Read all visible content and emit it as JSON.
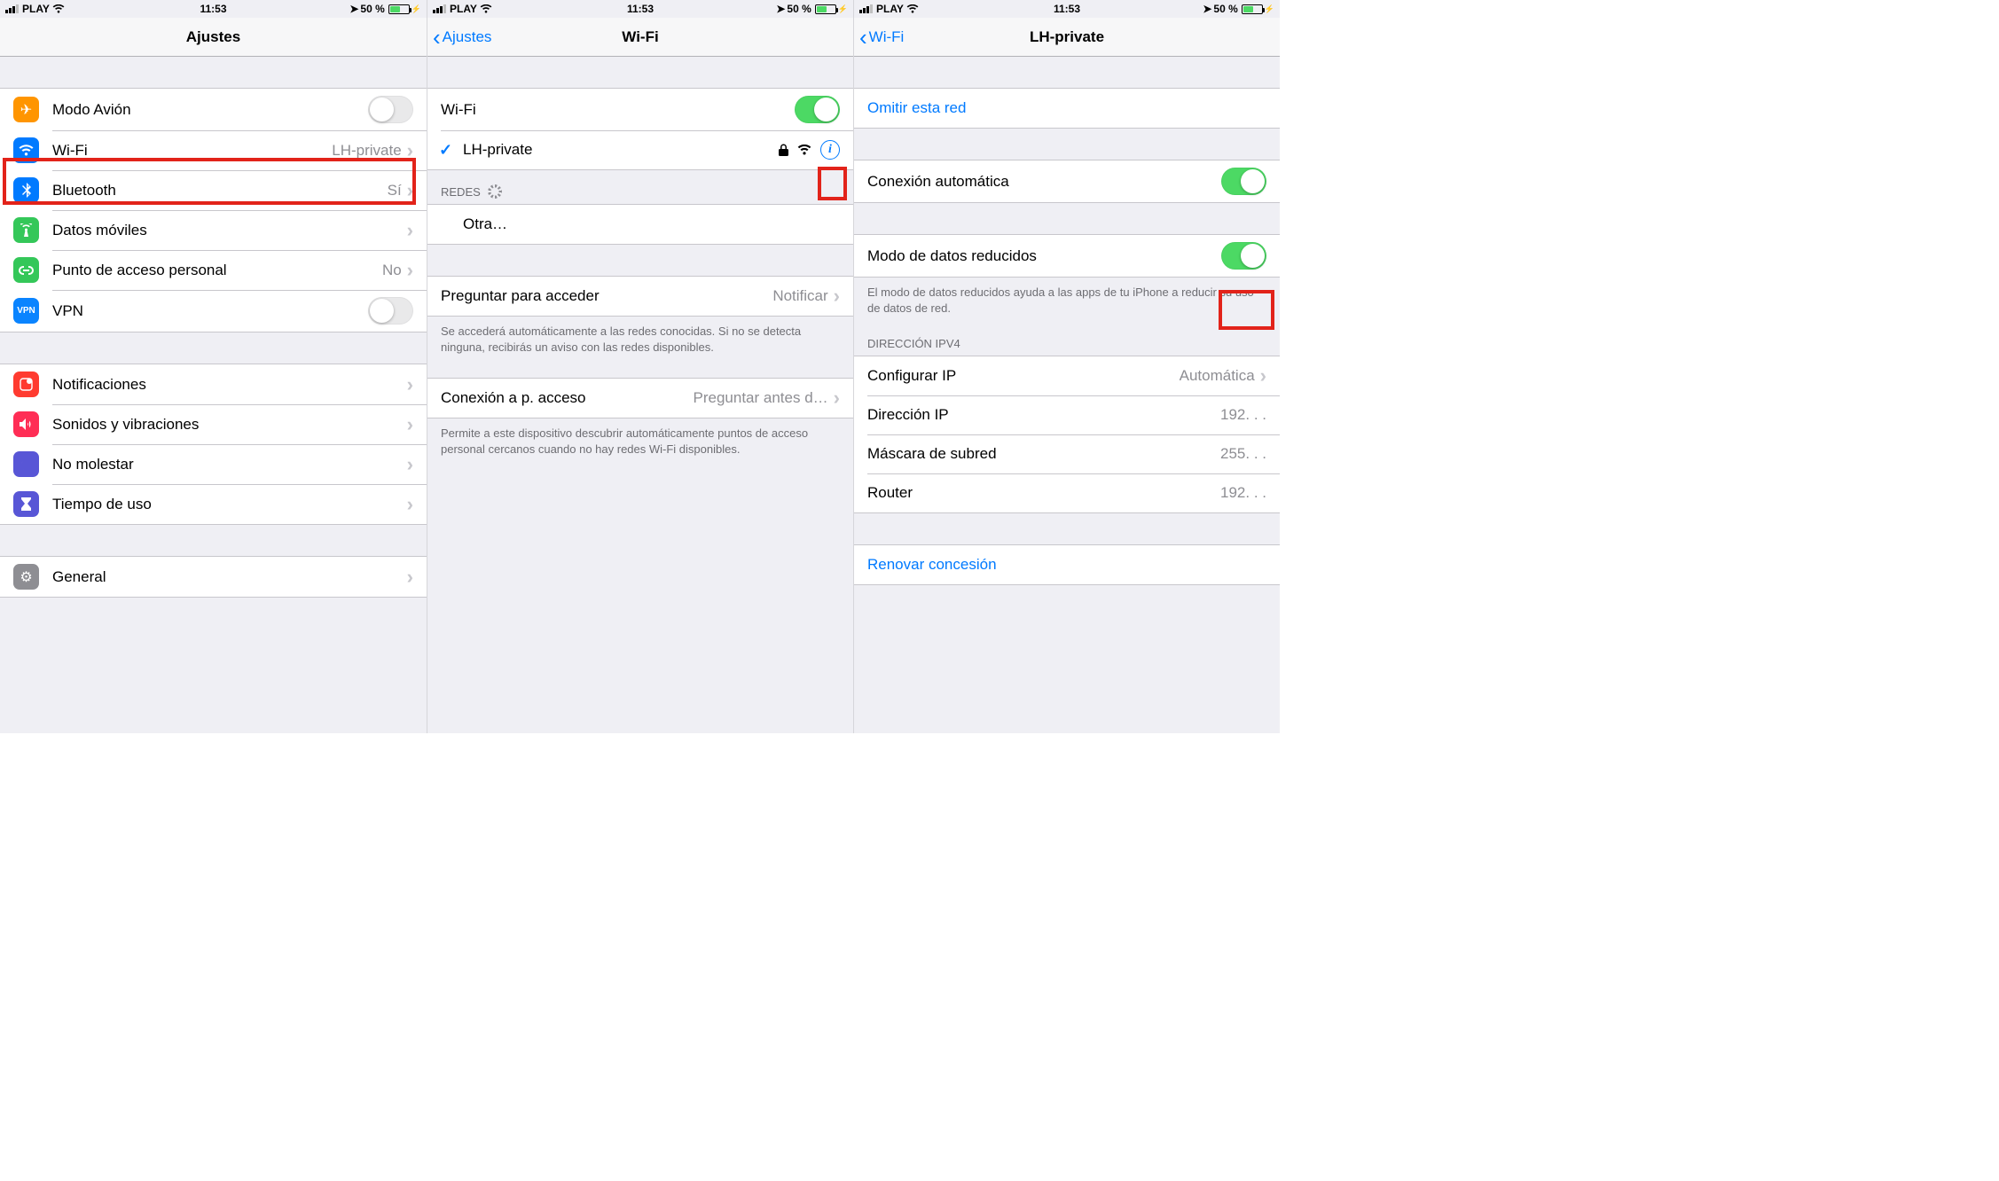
{
  "status": {
    "carrier": "PLAY",
    "time": "11:53",
    "battery": "50 %"
  },
  "pane1": {
    "title": "Ajustes",
    "items": {
      "airplane": {
        "label": "Modo Avión"
      },
      "wifi": {
        "label": "Wi-Fi",
        "detail": "LH-private"
      },
      "bluetooth": {
        "label": "Bluetooth",
        "detail": "Sí"
      },
      "cellular": {
        "label": "Datos móviles"
      },
      "hotspot": {
        "label": "Punto de acceso personal",
        "detail": "No"
      },
      "vpn": {
        "label": "VPN",
        "badge": "VPN"
      },
      "notifications": {
        "label": "Notificaciones"
      },
      "sounds": {
        "label": "Sonidos y vibraciones"
      },
      "dnd": {
        "label": "No molestar"
      },
      "screentime": {
        "label": "Tiempo de uso"
      },
      "general": {
        "label": "General"
      }
    }
  },
  "pane2": {
    "back": "Ajustes",
    "title": "Wi-Fi",
    "wifi_label": "Wi-Fi",
    "connected_ssid": "LH-private",
    "section_networks": "REDES",
    "other": "Otra…",
    "ask": {
      "label": "Preguntar para acceder",
      "detail": "Notificar"
    },
    "ask_footer": "Se accederá automáticamente a las redes conocidas. Si no se detecta ninguna, recibirás un aviso con las redes disponibles.",
    "hotspot": {
      "label": "Conexión a p. acceso",
      "detail": "Preguntar antes d…"
    },
    "hotspot_footer": "Permite a este dispositivo descubrir automáticamente puntos de acceso personal cercanos cuando no hay redes Wi-Fi disponibles."
  },
  "pane3": {
    "back": "Wi-Fi",
    "title": "LH-private",
    "forget": "Omitir esta red",
    "auto_join": "Conexión automática",
    "low_data": "Modo de datos reducidos",
    "low_data_footer": "El modo de datos reducidos ayuda a las apps de tu iPhone a reducir su uso de datos de red.",
    "section_ipv4": "DIRECCIÓN IPV4",
    "configure_ip": {
      "label": "Configurar IP",
      "detail": "Automática"
    },
    "ip": {
      "label": "Dirección IP",
      "detail": "192.     .     ."
    },
    "mask": {
      "label": "Máscara de subred",
      "detail": "255.     .     ."
    },
    "router": {
      "label": "Router",
      "detail": "192.     .     ."
    },
    "renew": "Renovar concesión"
  }
}
